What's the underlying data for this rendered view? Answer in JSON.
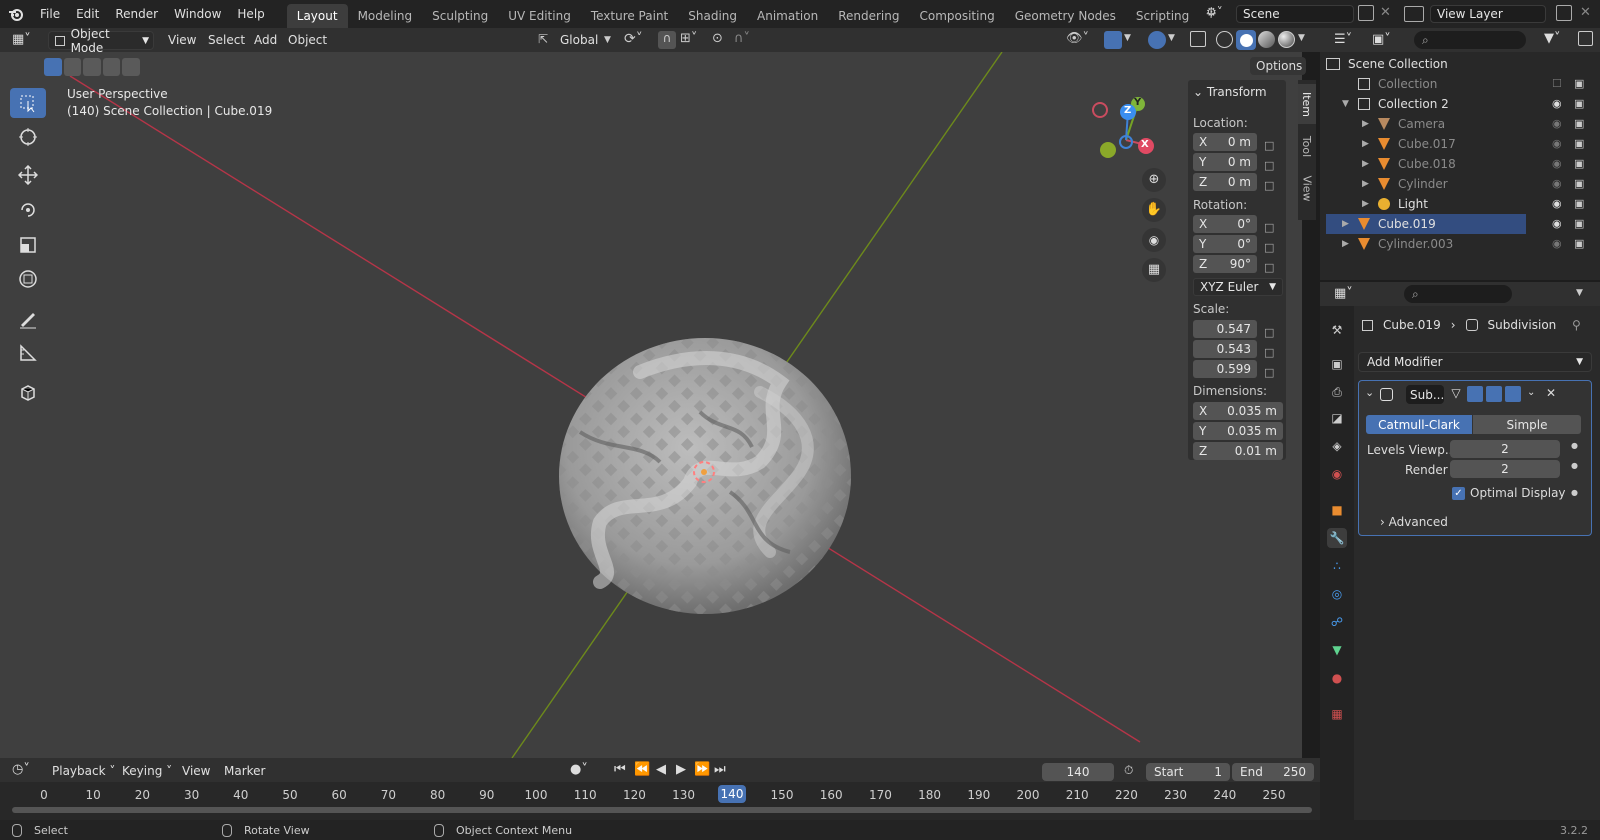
{
  "topbar": {
    "menus": [
      "File",
      "Edit",
      "Render",
      "Window",
      "Help"
    ],
    "workspaces": [
      "Layout",
      "Modeling",
      "Sculpting",
      "UV Editing",
      "Texture Paint",
      "Shading",
      "Animation",
      "Rendering",
      "Compositing",
      "Geometry Nodes",
      "Scripting"
    ],
    "active_workspace": "Layout",
    "scene": "Scene",
    "view_layer": "View Layer"
  },
  "viewport_header": {
    "mode": "Object Mode",
    "menus": [
      "View",
      "Select",
      "Add",
      "Object"
    ],
    "orientation": "Global",
    "options": "Options"
  },
  "viewport": {
    "perspective": "User Perspective",
    "context": "(140) Scene Collection | Cube.019",
    "gizmo": {
      "x": "X",
      "y": "Y",
      "z": "Z"
    }
  },
  "npanel": {
    "tabs": [
      "Item",
      "Tool",
      "View"
    ],
    "section": "Transform",
    "location_label": "Location:",
    "location": [
      {
        "axis": "X",
        "value": "0 m"
      },
      {
        "axis": "Y",
        "value": "0 m"
      },
      {
        "axis": "Z",
        "value": "0 m"
      }
    ],
    "rotation_label": "Rotation:",
    "rotation": [
      {
        "axis": "X",
        "value": "0°"
      },
      {
        "axis": "Y",
        "value": "0°"
      },
      {
        "axis": "Z",
        "value": "90°"
      }
    ],
    "rotation_mode": "XYZ Euler",
    "scale_label": "Scale:",
    "scale": [
      "0.547",
      "0.543",
      "0.599"
    ],
    "dimensions_label": "Dimensions:",
    "dimensions": [
      {
        "axis": "X",
        "value": "0.035 m"
      },
      {
        "axis": "Y",
        "value": "0.035 m"
      },
      {
        "axis": "Z",
        "value": "0.01 m"
      }
    ]
  },
  "outliner": {
    "root": "Scene Collection",
    "items": [
      {
        "name": "Collection",
        "dim": true
      },
      {
        "name": "Collection 2",
        "dim": false
      },
      {
        "name": "Camera",
        "dim": true
      },
      {
        "name": "Cube.017",
        "dim": true
      },
      {
        "name": "Cube.018",
        "dim": true
      },
      {
        "name": "Cylinder",
        "dim": true
      },
      {
        "name": "Light",
        "dim": false
      },
      {
        "name": "Cube.019",
        "dim": false
      },
      {
        "name": "Cylinder.003",
        "dim": true
      }
    ]
  },
  "properties": {
    "object": "Cube.019",
    "modifier": "Subdivision",
    "add_modifier": "Add Modifier",
    "modifier_short": "Sub...",
    "algo_a": "Catmull-Clark",
    "algo_b": "Simple",
    "levels_viewport_label": "Levels Viewp...",
    "levels_viewport": "2",
    "render_label": "Render",
    "render_levels": "2",
    "optimal_display": "Optimal Display",
    "advanced": "Advanced"
  },
  "timeline": {
    "menus": [
      "Playback",
      "Keying",
      "View",
      "Marker"
    ],
    "current_frame": "140",
    "start_label": "Start",
    "start": "1",
    "end_label": "End",
    "end": "250",
    "ticks": [
      "0",
      "10",
      "20",
      "30",
      "40",
      "50",
      "60",
      "70",
      "80",
      "90",
      "100",
      "110",
      "120",
      "130",
      "140",
      "150",
      "160",
      "170",
      "180",
      "190",
      "200",
      "210",
      "220",
      "230",
      "240",
      "250"
    ]
  },
  "statusbar": {
    "select": "Select",
    "rotate": "Rotate View",
    "context_menu": "Object Context Menu",
    "version": "3.2.2"
  },
  "colors": {
    "accent": "#4772b3",
    "x_axis": "#ff3352",
    "y_axis": "#8bdc00",
    "z_axis": "#2890ff",
    "object_orange": "#e98c30",
    "mesh_green": "#5fd38f"
  }
}
